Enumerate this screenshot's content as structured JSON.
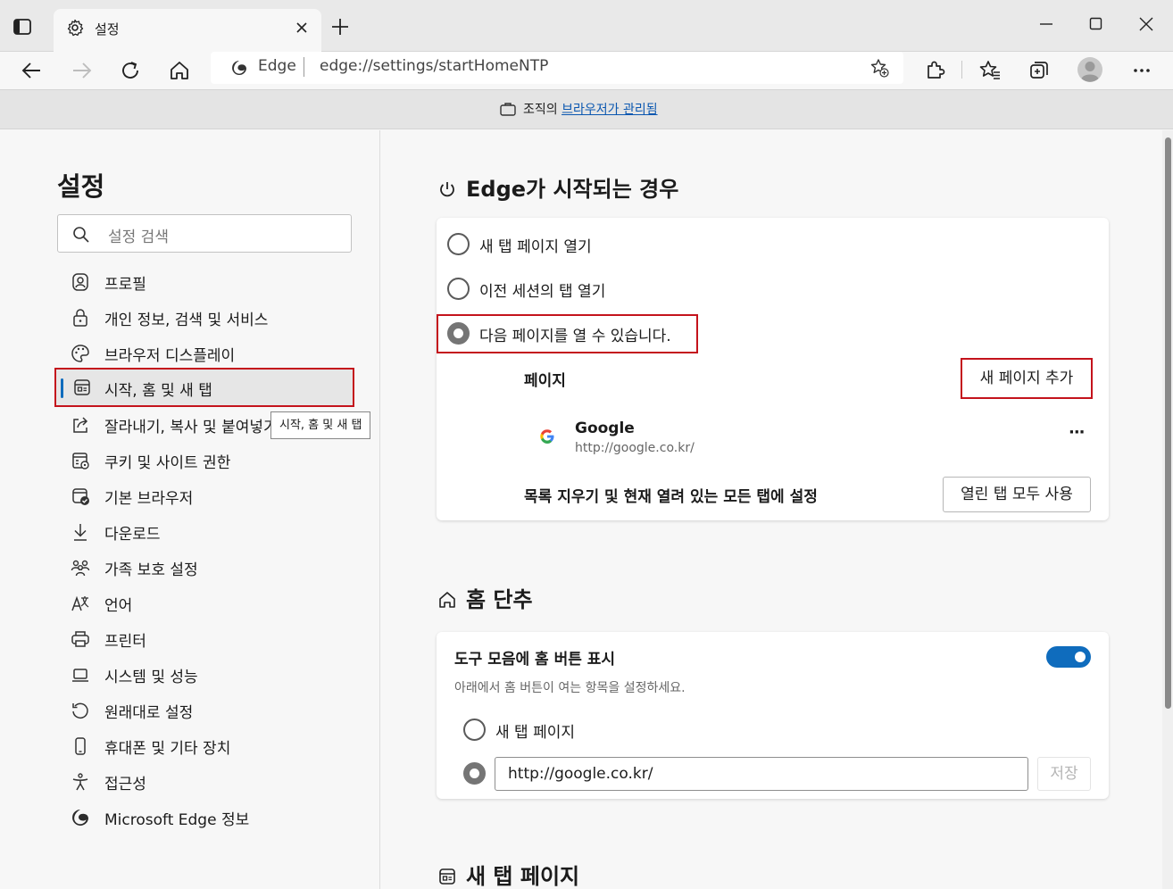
{
  "browser": {
    "tab_title": "설정",
    "brand": "Edge",
    "url": "edge://settings/startHomeNTP"
  },
  "managed_bar": {
    "prefix": "조직의",
    "link": "브라우저가 관리됨"
  },
  "sidebar": {
    "title": "설정",
    "search_placeholder": "설정 검색",
    "items": [
      {
        "label": "프로필"
      },
      {
        "label": "개인 정보, 검색 및 서비스"
      },
      {
        "label": "브라우저 디스플레이"
      },
      {
        "label": "시작, 홈 및 새 탭"
      },
      {
        "label": "잘라내기, 복사 및 붙여넣기"
      },
      {
        "label": "쿠키 및 사이트 권한"
      },
      {
        "label": "기본 브라우저"
      },
      {
        "label": "다운로드"
      },
      {
        "label": "가족 보호 설정"
      },
      {
        "label": "언어"
      },
      {
        "label": "프린터"
      },
      {
        "label": "시스템 및 성능"
      },
      {
        "label": "원래대로 설정"
      },
      {
        "label": "휴대폰 및 기타 장치"
      },
      {
        "label": "접근성"
      },
      {
        "label": "Microsoft Edge 정보"
      }
    ],
    "selected_index": 3,
    "tooltip": "시작, 홈 및 새 탭"
  },
  "startup": {
    "title": "Edge가 시작되는 경우",
    "options": [
      "새 탭 페이지 열기",
      "이전 세션의 탭 열기",
      "다음 페이지를 열 수 있습니다."
    ],
    "selected_option": 2,
    "pages_label": "페이지",
    "add_page_button": "새 페이지 추가",
    "page_entry": {
      "name": "Google",
      "url": "http://google.co.kr/",
      "more": "···"
    },
    "clear_label": "목록 지우기 및 현재 열려 있는 모든 탭에 설정",
    "use_all_tabs_button": "열린 탭 모두 사용"
  },
  "home": {
    "title": "홈 단추",
    "toggle_label": "도구 모음에 홈 버튼 표시",
    "toggle_on": true,
    "description": "아래에서 홈 버튼이 여는 항목을 설정하세요.",
    "option_new_tab": "새 탭 페이지",
    "url_value": "http://google.co.kr/",
    "save_button": "저장"
  },
  "newtab": {
    "title": "새 탭 페이지"
  },
  "colors": {
    "accent": "#0f6cbd",
    "highlight": "#c4131c",
    "link": "#0b57b0"
  }
}
